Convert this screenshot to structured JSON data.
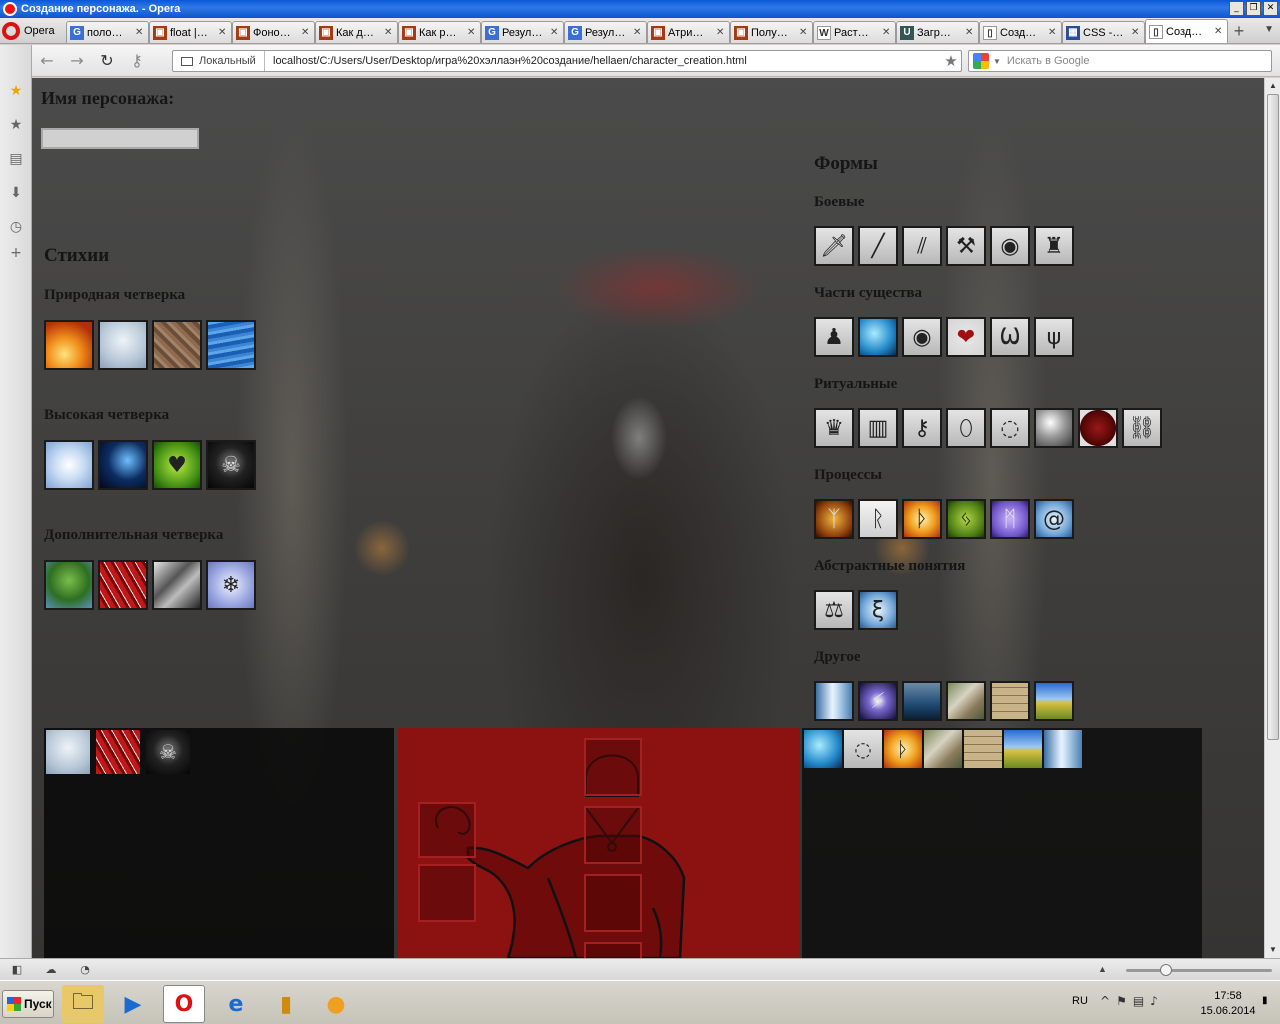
{
  "window": {
    "title": "Создание персонажа. - Opera"
  },
  "opera_menu": {
    "label": "Opera"
  },
  "tabs": [
    {
      "icon": "G",
      "label": "поло…",
      "color": "#3b6fd8"
    },
    {
      "icon": "▣",
      "label": "float |…",
      "color": "#a63a12"
    },
    {
      "icon": "▣",
      "label": "Фоно…",
      "color": "#a63a12"
    },
    {
      "icon": "▣",
      "label": "Как д…",
      "color": "#a63a12"
    },
    {
      "icon": "▣",
      "label": "Как р…",
      "color": "#a63a12"
    },
    {
      "icon": "G",
      "label": "Резул…",
      "color": "#3b6fd8"
    },
    {
      "icon": "G",
      "label": "Резул…",
      "color": "#3b6fd8"
    },
    {
      "icon": "▣",
      "label": "Атри…",
      "color": "#a63a12"
    },
    {
      "icon": "▣",
      "label": "Полу…",
      "color": "#a63a12"
    },
    {
      "icon": "W",
      "label": "Раст…",
      "color": "#ffffff"
    },
    {
      "icon": "U",
      "label": "Загр…",
      "color": "#355"
    },
    {
      "icon": "▯",
      "label": "Созд…",
      "color": "#ffffff"
    },
    {
      "icon": "▦",
      "label": "CSS -…",
      "color": "#2a4f9a"
    },
    {
      "icon": "▯",
      "label": "Созд…",
      "color": "#ffffff"
    }
  ],
  "address": {
    "zone": "Локальный",
    "url": "localhost/C:/Users/User/Desktop/игра%20хэллаэн%20создание/hellaen/character_creation.html"
  },
  "search": {
    "placeholder": "Искать в Google"
  },
  "page": {
    "name_label": "Имя персонажа:",
    "elements_title": "Стихии",
    "natural_four": "Природная четверка",
    "high_four": "Высокая четверка",
    "extra_four": "Дополнительная четверка",
    "forms_title": "Формы",
    "combat": "Боевые",
    "creature_parts": "Части существа",
    "ritual": "Ритуальные",
    "processes": "Процессы",
    "abstract": "Абстрактные понятия",
    "other": "Другое"
  },
  "icons": {
    "natural": [
      "fire-icon",
      "air-icon",
      "earth-icon",
      "water-icon"
    ],
    "high": [
      "light-icon",
      "darkness-icon",
      "life-icon",
      "death-icon"
    ],
    "extra": [
      "tree-icon",
      "blood-icon",
      "metal-icon",
      "ice-icon"
    ],
    "combat": [
      "sword-icon",
      "spear-icon",
      "arrows-icon",
      "hammer-icon",
      "shield-icon",
      "armor-icon"
    ],
    "creature": [
      "body-icon",
      "spirit-icon",
      "eye-icon",
      "heart-icon",
      "wings-icon",
      "claws-icon"
    ],
    "ritual": [
      "crown-icon",
      "gate-icon",
      "key-icon",
      "mirror-icon",
      "rune-circle-icon",
      "crystal-ball-icon",
      "wax-seal-icon",
      "shackle-icon"
    ],
    "processes": [
      "rune-fire-icon",
      "rune-scroll-icon",
      "rune-burst-icon",
      "rune-growth-icon",
      "rune-magic-icon",
      "rune-spiral-icon"
    ],
    "abstract": [
      "scales-icon",
      "chaos-rune-icon"
    ],
    "other": [
      "waterfall-icon",
      "storm-icon",
      "ocean-icon",
      "rocks-icon",
      "wall-icon",
      "field-icon"
    ]
  },
  "selected": {
    "elements": [
      "air-icon",
      "blood-icon",
      "death-icon"
    ],
    "forms": [
      "spirit-icon",
      "rune-circle-icon",
      "rune-burst-icon",
      "rocks-icon",
      "wall-icon",
      "field-icon",
      "waterfall-icon"
    ]
  },
  "taskbar": {
    "start": "Пуск",
    "lang": "RU",
    "time": "17:58",
    "date": "15.06.2014"
  }
}
